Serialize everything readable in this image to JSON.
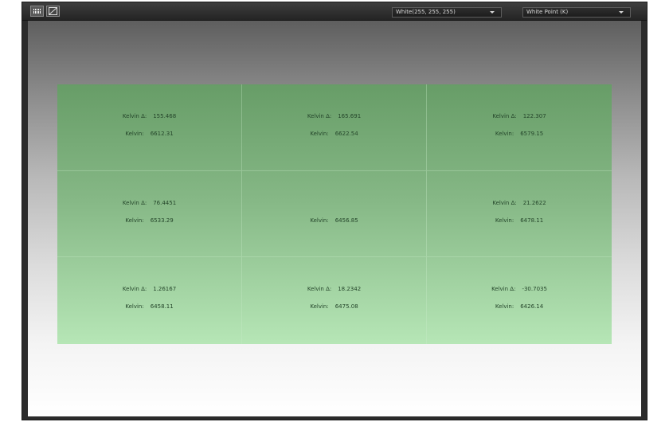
{
  "toolbar": {
    "grid_tool_icon": "grid-icon",
    "curve_tool_icon": "curve-icon",
    "color_select": {
      "value": "White(255, 255, 255)"
    },
    "mode_select": {
      "value": "White Point (K)"
    }
  },
  "labels": {
    "kelvin_delta": "Kelvin Δ:",
    "kelvin": "Kelvin:"
  },
  "cells": [
    {
      "delta": "155.468",
      "kelvin": "6612.31"
    },
    {
      "delta": "165.691",
      "kelvin": "6622.54"
    },
    {
      "delta": "122.307",
      "kelvin": "6579.15"
    },
    {
      "delta": "76.4451",
      "kelvin": "6533.29"
    },
    {
      "delta": null,
      "kelvin": "6456.85"
    },
    {
      "delta": "21.2622",
      "kelvin": "6478.11"
    },
    {
      "delta": "1.26167",
      "kelvin": "6458.11"
    },
    {
      "delta": "18.2342",
      "kelvin": "6475.08"
    },
    {
      "delta": "-30.7035",
      "kelvin": "6426.14"
    }
  ],
  "colors": {
    "grid_top": "#679d67",
    "grid_bottom": "#b6e6b6",
    "toolbar_bg": "#2b2b2b"
  }
}
